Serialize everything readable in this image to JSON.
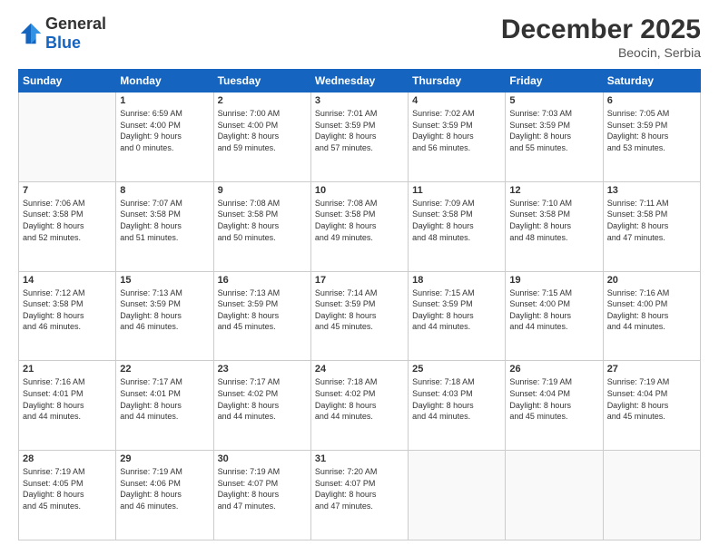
{
  "header": {
    "logo_general": "General",
    "logo_blue": "Blue",
    "month_title": "December 2025",
    "location": "Beocin, Serbia"
  },
  "weekdays": [
    "Sunday",
    "Monday",
    "Tuesday",
    "Wednesday",
    "Thursday",
    "Friday",
    "Saturday"
  ],
  "weeks": [
    [
      {
        "day": "",
        "info": ""
      },
      {
        "day": "1",
        "info": "Sunrise: 6:59 AM\nSunset: 4:00 PM\nDaylight: 9 hours\nand 0 minutes."
      },
      {
        "day": "2",
        "info": "Sunrise: 7:00 AM\nSunset: 4:00 PM\nDaylight: 8 hours\nand 59 minutes."
      },
      {
        "day": "3",
        "info": "Sunrise: 7:01 AM\nSunset: 3:59 PM\nDaylight: 8 hours\nand 57 minutes."
      },
      {
        "day": "4",
        "info": "Sunrise: 7:02 AM\nSunset: 3:59 PM\nDaylight: 8 hours\nand 56 minutes."
      },
      {
        "day": "5",
        "info": "Sunrise: 7:03 AM\nSunset: 3:59 PM\nDaylight: 8 hours\nand 55 minutes."
      },
      {
        "day": "6",
        "info": "Sunrise: 7:05 AM\nSunset: 3:59 PM\nDaylight: 8 hours\nand 53 minutes."
      }
    ],
    [
      {
        "day": "7",
        "info": "Sunrise: 7:06 AM\nSunset: 3:58 PM\nDaylight: 8 hours\nand 52 minutes."
      },
      {
        "day": "8",
        "info": "Sunrise: 7:07 AM\nSunset: 3:58 PM\nDaylight: 8 hours\nand 51 minutes."
      },
      {
        "day": "9",
        "info": "Sunrise: 7:08 AM\nSunset: 3:58 PM\nDaylight: 8 hours\nand 50 minutes."
      },
      {
        "day": "10",
        "info": "Sunrise: 7:08 AM\nSunset: 3:58 PM\nDaylight: 8 hours\nand 49 minutes."
      },
      {
        "day": "11",
        "info": "Sunrise: 7:09 AM\nSunset: 3:58 PM\nDaylight: 8 hours\nand 48 minutes."
      },
      {
        "day": "12",
        "info": "Sunrise: 7:10 AM\nSunset: 3:58 PM\nDaylight: 8 hours\nand 48 minutes."
      },
      {
        "day": "13",
        "info": "Sunrise: 7:11 AM\nSunset: 3:58 PM\nDaylight: 8 hours\nand 47 minutes."
      }
    ],
    [
      {
        "day": "14",
        "info": "Sunrise: 7:12 AM\nSunset: 3:58 PM\nDaylight: 8 hours\nand 46 minutes."
      },
      {
        "day": "15",
        "info": "Sunrise: 7:13 AM\nSunset: 3:59 PM\nDaylight: 8 hours\nand 46 minutes."
      },
      {
        "day": "16",
        "info": "Sunrise: 7:13 AM\nSunset: 3:59 PM\nDaylight: 8 hours\nand 45 minutes."
      },
      {
        "day": "17",
        "info": "Sunrise: 7:14 AM\nSunset: 3:59 PM\nDaylight: 8 hours\nand 45 minutes."
      },
      {
        "day": "18",
        "info": "Sunrise: 7:15 AM\nSunset: 3:59 PM\nDaylight: 8 hours\nand 44 minutes."
      },
      {
        "day": "19",
        "info": "Sunrise: 7:15 AM\nSunset: 4:00 PM\nDaylight: 8 hours\nand 44 minutes."
      },
      {
        "day": "20",
        "info": "Sunrise: 7:16 AM\nSunset: 4:00 PM\nDaylight: 8 hours\nand 44 minutes."
      }
    ],
    [
      {
        "day": "21",
        "info": "Sunrise: 7:16 AM\nSunset: 4:01 PM\nDaylight: 8 hours\nand 44 minutes."
      },
      {
        "day": "22",
        "info": "Sunrise: 7:17 AM\nSunset: 4:01 PM\nDaylight: 8 hours\nand 44 minutes."
      },
      {
        "day": "23",
        "info": "Sunrise: 7:17 AM\nSunset: 4:02 PM\nDaylight: 8 hours\nand 44 minutes."
      },
      {
        "day": "24",
        "info": "Sunrise: 7:18 AM\nSunset: 4:02 PM\nDaylight: 8 hours\nand 44 minutes."
      },
      {
        "day": "25",
        "info": "Sunrise: 7:18 AM\nSunset: 4:03 PM\nDaylight: 8 hours\nand 44 minutes."
      },
      {
        "day": "26",
        "info": "Sunrise: 7:19 AM\nSunset: 4:04 PM\nDaylight: 8 hours\nand 45 minutes."
      },
      {
        "day": "27",
        "info": "Sunrise: 7:19 AM\nSunset: 4:04 PM\nDaylight: 8 hours\nand 45 minutes."
      }
    ],
    [
      {
        "day": "28",
        "info": "Sunrise: 7:19 AM\nSunset: 4:05 PM\nDaylight: 8 hours\nand 45 minutes."
      },
      {
        "day": "29",
        "info": "Sunrise: 7:19 AM\nSunset: 4:06 PM\nDaylight: 8 hours\nand 46 minutes."
      },
      {
        "day": "30",
        "info": "Sunrise: 7:19 AM\nSunset: 4:07 PM\nDaylight: 8 hours\nand 47 minutes."
      },
      {
        "day": "31",
        "info": "Sunrise: 7:20 AM\nSunset: 4:07 PM\nDaylight: 8 hours\nand 47 minutes."
      },
      {
        "day": "",
        "info": ""
      },
      {
        "day": "",
        "info": ""
      },
      {
        "day": "",
        "info": ""
      }
    ]
  ]
}
